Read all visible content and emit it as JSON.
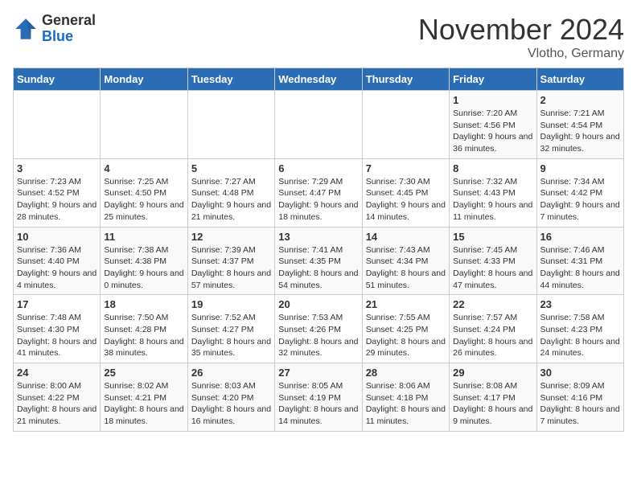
{
  "header": {
    "logo_general": "General",
    "logo_blue": "Blue",
    "month_title": "November 2024",
    "location": "Vlotho, Germany"
  },
  "weekdays": [
    "Sunday",
    "Monday",
    "Tuesday",
    "Wednesday",
    "Thursday",
    "Friday",
    "Saturday"
  ],
  "weeks": [
    [
      {
        "day": "",
        "sunrise": "",
        "sunset": "",
        "daylight": ""
      },
      {
        "day": "",
        "sunrise": "",
        "sunset": "",
        "daylight": ""
      },
      {
        "day": "",
        "sunrise": "",
        "sunset": "",
        "daylight": ""
      },
      {
        "day": "",
        "sunrise": "",
        "sunset": "",
        "daylight": ""
      },
      {
        "day": "",
        "sunrise": "",
        "sunset": "",
        "daylight": ""
      },
      {
        "day": "1",
        "sunrise": "Sunrise: 7:20 AM",
        "sunset": "Sunset: 4:56 PM",
        "daylight": "Daylight: 9 hours and 36 minutes."
      },
      {
        "day": "2",
        "sunrise": "Sunrise: 7:21 AM",
        "sunset": "Sunset: 4:54 PM",
        "daylight": "Daylight: 9 hours and 32 minutes."
      }
    ],
    [
      {
        "day": "3",
        "sunrise": "Sunrise: 7:23 AM",
        "sunset": "Sunset: 4:52 PM",
        "daylight": "Daylight: 9 hours and 28 minutes."
      },
      {
        "day": "4",
        "sunrise": "Sunrise: 7:25 AM",
        "sunset": "Sunset: 4:50 PM",
        "daylight": "Daylight: 9 hours and 25 minutes."
      },
      {
        "day": "5",
        "sunrise": "Sunrise: 7:27 AM",
        "sunset": "Sunset: 4:48 PM",
        "daylight": "Daylight: 9 hours and 21 minutes."
      },
      {
        "day": "6",
        "sunrise": "Sunrise: 7:29 AM",
        "sunset": "Sunset: 4:47 PM",
        "daylight": "Daylight: 9 hours and 18 minutes."
      },
      {
        "day": "7",
        "sunrise": "Sunrise: 7:30 AM",
        "sunset": "Sunset: 4:45 PM",
        "daylight": "Daylight: 9 hours and 14 minutes."
      },
      {
        "day": "8",
        "sunrise": "Sunrise: 7:32 AM",
        "sunset": "Sunset: 4:43 PM",
        "daylight": "Daylight: 9 hours and 11 minutes."
      },
      {
        "day": "9",
        "sunrise": "Sunrise: 7:34 AM",
        "sunset": "Sunset: 4:42 PM",
        "daylight": "Daylight: 9 hours and 7 minutes."
      }
    ],
    [
      {
        "day": "10",
        "sunrise": "Sunrise: 7:36 AM",
        "sunset": "Sunset: 4:40 PM",
        "daylight": "Daylight: 9 hours and 4 minutes."
      },
      {
        "day": "11",
        "sunrise": "Sunrise: 7:38 AM",
        "sunset": "Sunset: 4:38 PM",
        "daylight": "Daylight: 9 hours and 0 minutes."
      },
      {
        "day": "12",
        "sunrise": "Sunrise: 7:39 AM",
        "sunset": "Sunset: 4:37 PM",
        "daylight": "Daylight: 8 hours and 57 minutes."
      },
      {
        "day": "13",
        "sunrise": "Sunrise: 7:41 AM",
        "sunset": "Sunset: 4:35 PM",
        "daylight": "Daylight: 8 hours and 54 minutes."
      },
      {
        "day": "14",
        "sunrise": "Sunrise: 7:43 AM",
        "sunset": "Sunset: 4:34 PM",
        "daylight": "Daylight: 8 hours and 51 minutes."
      },
      {
        "day": "15",
        "sunrise": "Sunrise: 7:45 AM",
        "sunset": "Sunset: 4:33 PM",
        "daylight": "Daylight: 8 hours and 47 minutes."
      },
      {
        "day": "16",
        "sunrise": "Sunrise: 7:46 AM",
        "sunset": "Sunset: 4:31 PM",
        "daylight": "Daylight: 8 hours and 44 minutes."
      }
    ],
    [
      {
        "day": "17",
        "sunrise": "Sunrise: 7:48 AM",
        "sunset": "Sunset: 4:30 PM",
        "daylight": "Daylight: 8 hours and 41 minutes."
      },
      {
        "day": "18",
        "sunrise": "Sunrise: 7:50 AM",
        "sunset": "Sunset: 4:28 PM",
        "daylight": "Daylight: 8 hours and 38 minutes."
      },
      {
        "day": "19",
        "sunrise": "Sunrise: 7:52 AM",
        "sunset": "Sunset: 4:27 PM",
        "daylight": "Daylight: 8 hours and 35 minutes."
      },
      {
        "day": "20",
        "sunrise": "Sunrise: 7:53 AM",
        "sunset": "Sunset: 4:26 PM",
        "daylight": "Daylight: 8 hours and 32 minutes."
      },
      {
        "day": "21",
        "sunrise": "Sunrise: 7:55 AM",
        "sunset": "Sunset: 4:25 PM",
        "daylight": "Daylight: 8 hours and 29 minutes."
      },
      {
        "day": "22",
        "sunrise": "Sunrise: 7:57 AM",
        "sunset": "Sunset: 4:24 PM",
        "daylight": "Daylight: 8 hours and 26 minutes."
      },
      {
        "day": "23",
        "sunrise": "Sunrise: 7:58 AM",
        "sunset": "Sunset: 4:23 PM",
        "daylight": "Daylight: 8 hours and 24 minutes."
      }
    ],
    [
      {
        "day": "24",
        "sunrise": "Sunrise: 8:00 AM",
        "sunset": "Sunset: 4:22 PM",
        "daylight": "Daylight: 8 hours and 21 minutes."
      },
      {
        "day": "25",
        "sunrise": "Sunrise: 8:02 AM",
        "sunset": "Sunset: 4:21 PM",
        "daylight": "Daylight: 8 hours and 18 minutes."
      },
      {
        "day": "26",
        "sunrise": "Sunrise: 8:03 AM",
        "sunset": "Sunset: 4:20 PM",
        "daylight": "Daylight: 8 hours and 16 minutes."
      },
      {
        "day": "27",
        "sunrise": "Sunrise: 8:05 AM",
        "sunset": "Sunset: 4:19 PM",
        "daylight": "Daylight: 8 hours and 14 minutes."
      },
      {
        "day": "28",
        "sunrise": "Sunrise: 8:06 AM",
        "sunset": "Sunset: 4:18 PM",
        "daylight": "Daylight: 8 hours and 11 minutes."
      },
      {
        "day": "29",
        "sunrise": "Sunrise: 8:08 AM",
        "sunset": "Sunset: 4:17 PM",
        "daylight": "Daylight: 8 hours and 9 minutes."
      },
      {
        "day": "30",
        "sunrise": "Sunrise: 8:09 AM",
        "sunset": "Sunset: 4:16 PM",
        "daylight": "Daylight: 8 hours and 7 minutes."
      }
    ]
  ]
}
